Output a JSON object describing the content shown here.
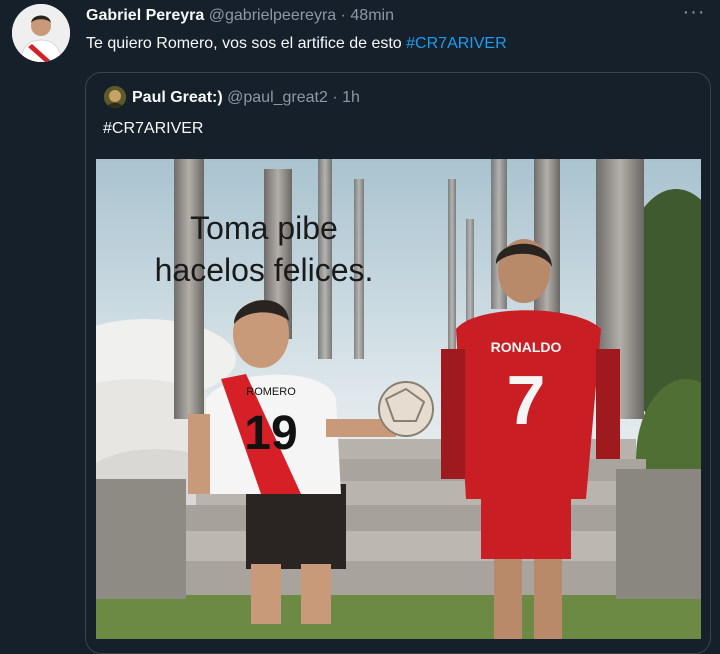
{
  "author": {
    "name": "Gabriel Pereyra",
    "handle": "@gabrielpeereyra",
    "separator": "·",
    "time": "48min",
    "avatar_icon": "profile-photo-icon"
  },
  "tweet": {
    "text": "Te quiero Romero, vos sos el artifice de esto ",
    "hashtag": "#CR7ARIVER"
  },
  "quoted": {
    "name": "Paul Great:)",
    "handle": "@paul_great2",
    "separator": "·",
    "time": "1h",
    "hashtag": "#CR7ARIVER",
    "image": {
      "caption_line1": "Toma pibe",
      "caption_line2": "hacelos felices.",
      "left_jersey_name": "ROMERO",
      "left_jersey_number": "19",
      "right_jersey_name": "RONALDO",
      "right_jersey_number": "7"
    }
  },
  "colors": {
    "background": "#15202b",
    "text": "#f7f9f9",
    "muted": "#8b98a5",
    "link": "#1d9bf0",
    "border": "#38444d"
  }
}
